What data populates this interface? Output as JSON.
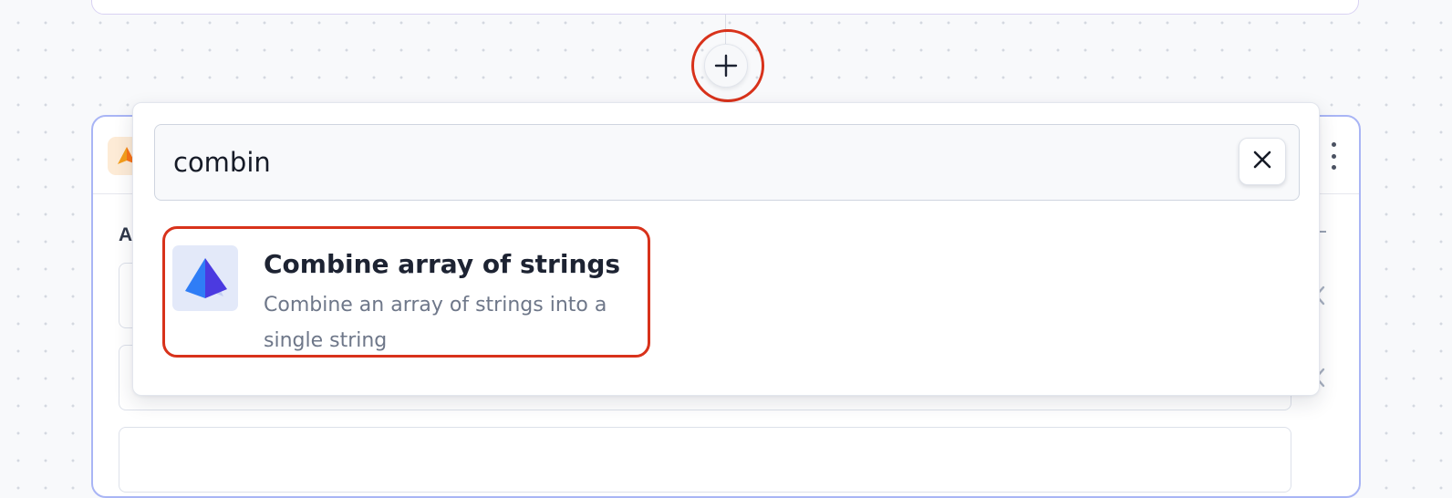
{
  "canvas": {
    "add_step_icon": "plus-icon"
  },
  "node": {
    "icon": "shapes-icon",
    "menu_icon": "more-vertical-icon",
    "section_letter": "A"
  },
  "search": {
    "value": "combin",
    "clear_icon": "close-icon"
  },
  "results": [
    {
      "title": "Combine array of strings",
      "description": "Combine an array of strings into a single string",
      "icon": "pyramid-icon"
    }
  ],
  "colors": {
    "highlight": "#d8321b",
    "selected_border": "#a9b5f5",
    "icon_blue": "#2f6cf6",
    "icon_violet": "#4b3ae0"
  }
}
